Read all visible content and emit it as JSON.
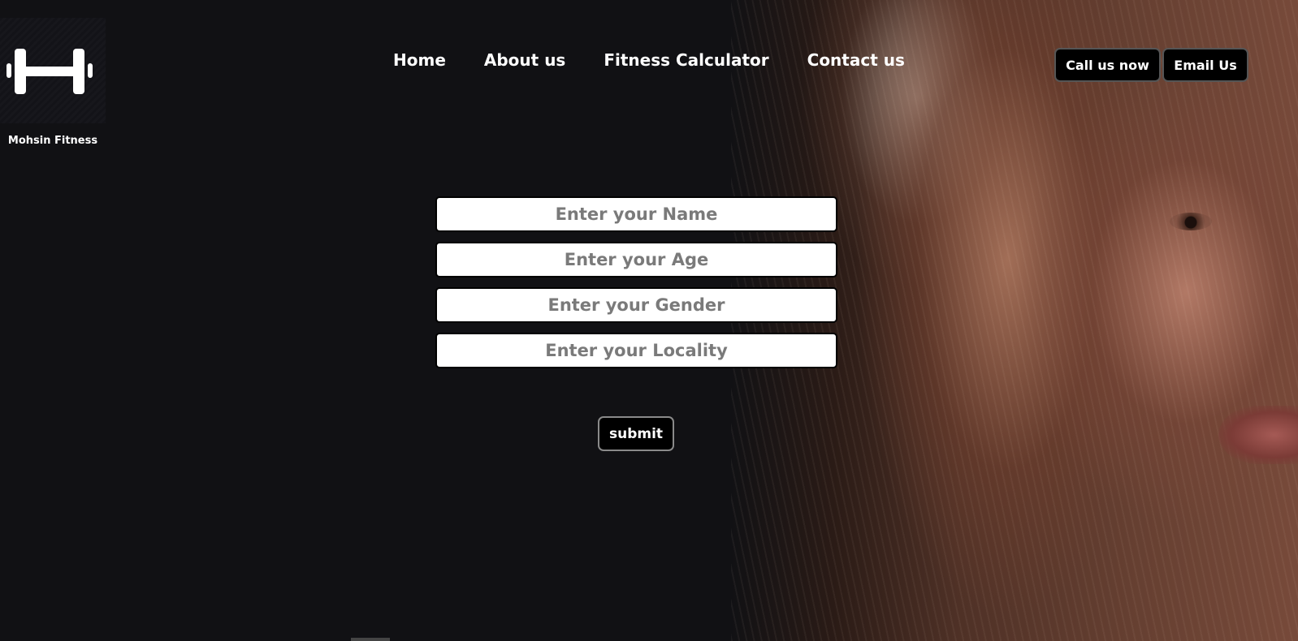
{
  "brand": {
    "name": "Mohsin Fitness",
    "logo_icon": "dumbbell-icon"
  },
  "nav": {
    "items": [
      {
        "label": "Home"
      },
      {
        "label": "About us"
      },
      {
        "label": "Fitness Calculator"
      },
      {
        "label": "Contact us"
      }
    ]
  },
  "actions": {
    "call_label": "Call us now",
    "email_label": "Email Us"
  },
  "form": {
    "name_placeholder": "Enter your Name",
    "age_placeholder": "Enter your Age",
    "gender_placeholder": "Enter your Gender",
    "locality_placeholder": "Enter your Locality",
    "name_value": "",
    "age_value": "",
    "gender_value": "",
    "locality_value": "",
    "submit_label": "submit"
  },
  "colors": {
    "background": "#111114",
    "button_bg": "#000000",
    "text": "#ffffff",
    "placeholder": "#7a7a7a"
  }
}
